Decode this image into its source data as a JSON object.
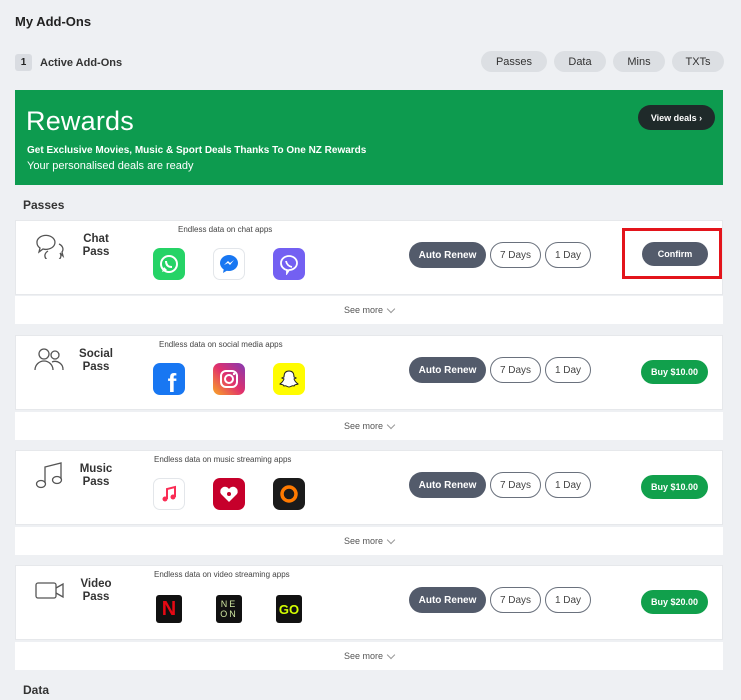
{
  "page": {
    "title": "My Add-Ons"
  },
  "active": {
    "count": "1",
    "label": "Active Add-Ons"
  },
  "filters": [
    "Passes",
    "Data",
    "Mins",
    "TXTs"
  ],
  "rewards": {
    "title": "Rewards",
    "subtitle": "Get Exclusive Movies, Music & Sport Deals Thanks To One NZ Rewards",
    "subtitle2": "Your personalised deals are ready",
    "cta": "View deals ›"
  },
  "sections": {
    "passes": "Passes",
    "data": "Data"
  },
  "common": {
    "auto_renew": "Auto Renew",
    "seven_days": "7 Days",
    "one_day": "1 Day",
    "see_more": "See more"
  },
  "passes": [
    {
      "name1": "Chat",
      "name2": "Pass",
      "desc": "Endless data on chat apps",
      "action": "Confirm",
      "apps": [
        "whatsapp-icon",
        "messenger-icon",
        "viber-icon"
      ]
    },
    {
      "name1": "Social",
      "name2": "Pass",
      "desc": "Endless data on social media apps",
      "action": "Buy $10.00",
      "apps": [
        "facebook-icon",
        "instagram-icon",
        "snapchat-icon"
      ]
    },
    {
      "name1": "Music",
      "name2": "Pass",
      "desc": "Endless data on music streaming apps",
      "action": "Buy $10.00",
      "apps": [
        "apple-music-icon",
        "iheartradio-icon",
        "other-music-icon"
      ]
    },
    {
      "name1": "Video",
      "name2": "Pass",
      "desc": "Endless data on video streaming apps",
      "action": "Buy $20.00",
      "apps": [
        "netflix-icon",
        "neon-icon",
        "go-icon"
      ]
    }
  ],
  "app_labels": {
    "neon_top": "NE",
    "neon_bottom": "ON",
    "go": "GO",
    "netflix": "N",
    "facebook": "f"
  },
  "colors": {
    "brand_green": "#0d9b4f",
    "buy_green": "#11a04c",
    "dark_pill": "#535b6b",
    "highlight_red": "#e3141b"
  }
}
